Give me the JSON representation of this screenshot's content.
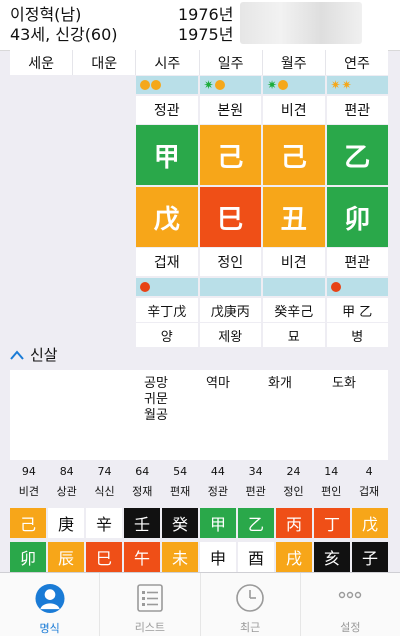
{
  "header": {
    "name": "이정혁(남)",
    "birth1": "1976년",
    "age": "43세, 신강(60)",
    "birth2": "1975년"
  },
  "labels": [
    "세운",
    "대운",
    "시주",
    "일주",
    "월주",
    "연주"
  ],
  "stars_top": [
    {
      "items": [
        "orange-circle",
        "orange-circle"
      ]
    },
    {
      "items": [
        "green-star",
        "orange-circle"
      ]
    },
    {
      "items": [
        "green-star",
        "orange-circle"
      ]
    },
    {
      "items": [
        "orange-star",
        "orange-star"
      ]
    }
  ],
  "top_gods": [
    "정관",
    "본원",
    "비견",
    "편관"
  ],
  "stems": [
    {
      "char": "甲",
      "color": "#2aa84a"
    },
    {
      "char": "己",
      "color": "#f7a619"
    },
    {
      "char": "己",
      "color": "#f7a619"
    },
    {
      "char": "乙",
      "color": "#2aa84a"
    }
  ],
  "branches": [
    {
      "char": "戊",
      "color": "#f7a619"
    },
    {
      "char": "巳",
      "color": "#ef4f17"
    },
    {
      "char": "丑",
      "color": "#f7a619"
    },
    {
      "char": "卯",
      "color": "#2aa84a"
    }
  ],
  "bottom_gods": [
    "겁재",
    "정인",
    "비견",
    "편관"
  ],
  "stars_bottom": [
    {
      "items": [
        "red-circle"
      ]
    },
    {
      "items": []
    },
    {
      "items": []
    },
    {
      "items": [
        "red-circle"
      ]
    }
  ],
  "hidden_stems": [
    "辛丁戊",
    "戊庚丙",
    "癸辛己",
    "甲 乙"
  ],
  "stages": [
    "양",
    "제왕",
    "묘",
    "병"
  ],
  "sinsal": {
    "title": "신살",
    "col1": [
      "공망",
      "귀문",
      "월공"
    ],
    "col2": "역마",
    "col3": "화개",
    "col4": "도화"
  },
  "daeun": {
    "ages": [
      "94",
      "84",
      "74",
      "64",
      "54",
      "44",
      "34",
      "24",
      "14",
      "4"
    ],
    "gods": [
      "비견",
      "상관",
      "식신",
      "정재",
      "편재",
      "정관",
      "편관",
      "정인",
      "편인",
      "겁재"
    ],
    "stems": [
      {
        "char": "己",
        "style": "ora"
      },
      {
        "char": "庚",
        "style": "wh"
      },
      {
        "char": "辛",
        "style": "wh"
      },
      {
        "char": "壬",
        "style": "bk"
      },
      {
        "char": "癸",
        "style": "bk"
      },
      {
        "char": "甲",
        "style": "gr"
      },
      {
        "char": "乙",
        "style": "gr"
      },
      {
        "char": "丙",
        "style": "rd"
      },
      {
        "char": "丁",
        "style": "rd"
      },
      {
        "char": "戊",
        "style": "ora"
      }
    ],
    "branches": [
      {
        "char": "卯",
        "style": "gr"
      },
      {
        "char": "辰",
        "style": "ora"
      },
      {
        "char": "巳",
        "style": "rd"
      },
      {
        "char": "午",
        "style": "rd"
      },
      {
        "char": "未",
        "style": "ora"
      },
      {
        "char": "申",
        "style": "wh"
      },
      {
        "char": "酉",
        "style": "wh"
      },
      {
        "char": "戌",
        "style": "ora"
      },
      {
        "char": "亥",
        "style": "bk"
      },
      {
        "char": "子",
        "style": "bk"
      }
    ]
  },
  "tabs": [
    {
      "label": "명식",
      "icon": "person-icon",
      "active": true
    },
    {
      "label": "리스트",
      "icon": "list-icon",
      "active": false
    },
    {
      "label": "최근",
      "icon": "clock-icon",
      "active": false
    },
    {
      "label": "설정",
      "icon": "more-icon",
      "active": false
    }
  ]
}
